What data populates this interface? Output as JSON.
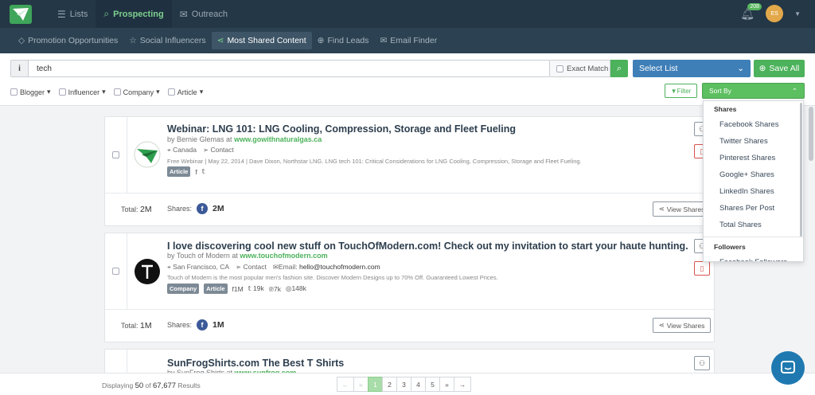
{
  "topnav": {
    "items": [
      {
        "label": "Lists",
        "icon": "list-icon"
      },
      {
        "label": "Prospecting",
        "icon": "search-icon"
      },
      {
        "label": "Outreach",
        "icon": "envelope-icon"
      }
    ],
    "active": "Prospecting",
    "notification_count": "208",
    "avatar_initials": "ES"
  },
  "subnav": {
    "items": [
      {
        "label": "Promotion Opportunities",
        "icon": "diamond-icon"
      },
      {
        "label": "Social Influencers",
        "icon": "star-icon"
      },
      {
        "label": "Most Shared Content",
        "icon": "share-icon"
      },
      {
        "label": "Find Leads",
        "icon": "globe-icon"
      },
      {
        "label": "Email Finder",
        "icon": "envelope-icon"
      }
    ],
    "active": "Most Shared Content"
  },
  "search": {
    "info_label": "i",
    "query": "tech",
    "exact_match_label": "Exact Match",
    "select_list_label": "Select List",
    "save_all_label": "Save All"
  },
  "filters": {
    "items": [
      "Blogger",
      "Influencer",
      "Company",
      "Article"
    ],
    "filter_label": "Filter",
    "sort_by_label": "Sort By"
  },
  "sort_dropdown": {
    "sections": [
      {
        "heading": "Shares",
        "items": [
          "Facebook Shares",
          "Twitter Shares",
          "Pinterest Shares",
          "Google+ Shares",
          "LinkedIn Shares",
          "Shares Per Post",
          "Total Shares"
        ]
      },
      {
        "heading": "Followers",
        "items": [
          "Facebook Followers"
        ]
      }
    ]
  },
  "results": [
    {
      "title": "Webinar: LNG 101: LNG Cooling, Compression, Storage and Fleet Fueling",
      "by": "by Bernie Glemas at",
      "site": "www.gowithnaturalgas.ca",
      "location": "Canada",
      "contact": "Contact",
      "description": "Free Webinar | May 22, 2014 | Dave Dixon, Northstar LNG. LNG tech 101: Critical Considerations for LNG Cooling, Compression, Storage and Fleet Fueling.",
      "tags": [
        "Article"
      ],
      "social": "f   t",
      "total_label": "Total:",
      "total": "2M",
      "shares_label": "Shares:",
      "fb_shares": "2M",
      "view_shares_label": "View Shares"
    },
    {
      "title": "I love discovering cool new stuff on TouchOfModern.com! Check out my invitation to start your haute hunting.",
      "by": "by Touch of Modern at",
      "site": "www.touchofmodern.com",
      "location": "San Francisco, CA",
      "contact": "Contact",
      "email_label": "Email:",
      "email": "hello@touchofmodern.com",
      "description": "Touch of Modern is the most popular men's fashion site. Discover Modern Designs up to 70% Off. Guaranteed Lowest Prices.",
      "tags": [
        "Company",
        "Article"
      ],
      "social_counts": [
        {
          "icon": "facebook-icon",
          "value": "1M"
        },
        {
          "icon": "twitter-icon",
          "value": "19k"
        },
        {
          "icon": "pinterest-icon",
          "value": "7k"
        },
        {
          "icon": "instagram-icon",
          "value": "148k"
        }
      ],
      "total_label": "Total:",
      "total": "1M",
      "shares_label": "Shares:",
      "fb_shares": "1M",
      "view_shares_label": "View Shares"
    },
    {
      "title": "SunFrogShirts.com The Best T Shirts",
      "by": "by SunFrog Shirts at",
      "site": "www.sunfrog.com"
    }
  ],
  "footer": {
    "displaying": "Displaying",
    "count": "50",
    "of": "of",
    "total": "67,677",
    "results_word": "Results",
    "pages": [
      "←",
      "«",
      "1",
      "2",
      "3",
      "4",
      "5",
      "»",
      "→"
    ],
    "active_page": "1"
  },
  "colors": {
    "topbar": "#243746",
    "subnav": "#2c4252",
    "accent_green": "#4cb25b",
    "select_blue": "#3f7fb8"
  }
}
